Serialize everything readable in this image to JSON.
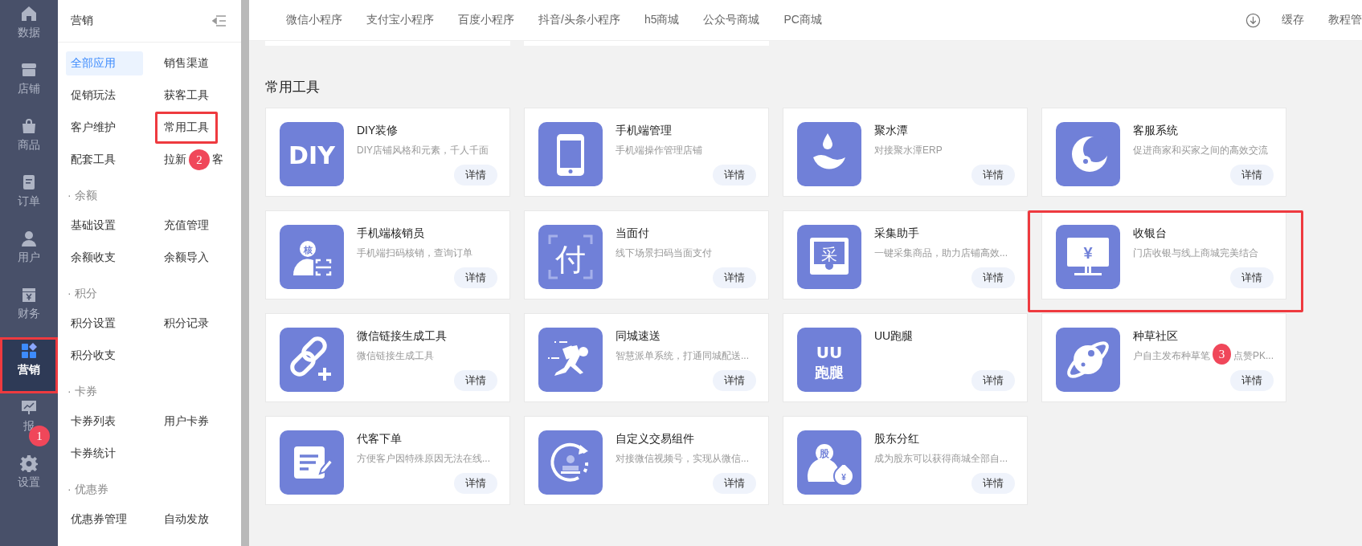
{
  "nav": [
    {
      "label": "数据",
      "selected": false,
      "highlighted": false
    },
    {
      "label": "店铺",
      "selected": false,
      "highlighted": false
    },
    {
      "label": "商品",
      "selected": false,
      "highlighted": false
    },
    {
      "label": "订单",
      "selected": false,
      "highlighted": false
    },
    {
      "label": "用户",
      "selected": false,
      "highlighted": false
    },
    {
      "label": "财务",
      "selected": false,
      "highlighted": false
    },
    {
      "label": "营销",
      "selected": true,
      "highlighted": true
    },
    {
      "label": "报",
      "selected": false,
      "highlighted": false,
      "badge": "1"
    },
    {
      "label": "设置",
      "selected": false,
      "highlighted": false
    }
  ],
  "sidebar": {
    "title": "营销",
    "sections": [
      {
        "items": [
          {
            "label": "全部应用",
            "selected": true,
            "highlighted": false
          },
          {
            "label": "销售渠道",
            "selected": false,
            "highlighted": false
          },
          {
            "label": "促销玩法",
            "selected": false,
            "highlighted": false
          },
          {
            "label": "获客工具",
            "selected": false,
            "highlighted": false
          },
          {
            "label": "客户维护",
            "selected": false,
            "highlighted": false
          },
          {
            "label": "常用工具",
            "selected": false,
            "highlighted": true
          },
          {
            "label": "配套工具",
            "selected": false,
            "highlighted": false
          },
          {
            "label": "拉新",
            "label_after": "客",
            "badge": "2",
            "selected": false,
            "highlighted": false
          }
        ]
      },
      {
        "title": "· 余额",
        "items": [
          {
            "label": "基础设置",
            "selected": false,
            "highlighted": false
          },
          {
            "label": "充值管理",
            "selected": false,
            "highlighted": false
          },
          {
            "label": "余额收支",
            "selected": false,
            "highlighted": false
          },
          {
            "label": "余额导入",
            "selected": false,
            "highlighted": false
          }
        ]
      },
      {
        "title": "· 积分",
        "items": [
          {
            "label": "积分设置",
            "selected": false,
            "highlighted": false
          },
          {
            "label": "积分记录",
            "selected": false,
            "highlighted": false
          },
          {
            "label": "积分收支",
            "selected": false,
            "highlighted": false
          }
        ]
      },
      {
        "title": "· 卡券",
        "items": [
          {
            "label": "卡券列表",
            "selected": false,
            "highlighted": false
          },
          {
            "label": "用户卡券",
            "selected": false,
            "highlighted": false
          },
          {
            "label": "卡券统计",
            "selected": false,
            "highlighted": false
          }
        ]
      },
      {
        "title": "· 优惠券",
        "items": [
          {
            "label": "优惠券管理",
            "selected": false,
            "highlighted": false
          },
          {
            "label": "自动发放",
            "selected": false,
            "highlighted": false
          }
        ]
      }
    ]
  },
  "tabs": [
    "微信小程序",
    "支付宝小程序",
    "百度小程序",
    "抖音/头条小程序",
    "h5商城",
    "公众号商城",
    "PC商城"
  ],
  "top_actions": [
    "缓存",
    "教程管"
  ],
  "section_title": "常用工具",
  "cards": [
    {
      "title": "DIY装修",
      "desc": "DIY店铺风格和元素，千人千面",
      "button": "详情",
      "highlighted": false,
      "icon_text": [
        "DIY"
      ]
    },
    {
      "title": "手机端管理",
      "desc": "手机端操作管理店铺",
      "button": "详情",
      "highlighted": false
    },
    {
      "title": "聚水潭",
      "desc": "对接聚水潭ERP",
      "button": "详情",
      "highlighted": false
    },
    {
      "title": "客服系统",
      "desc": "促进商家和买家之间的高效交流",
      "button": "详情",
      "highlighted": false
    },
    {
      "title": "手机端核销员",
      "desc": "手机端扫码核销，查询订单",
      "button": "详情",
      "highlighted": false,
      "icon_text": [
        "核"
      ]
    },
    {
      "title": "当面付",
      "desc": "线下场景扫码当面支付",
      "button": "详情",
      "highlighted": false,
      "icon_text": [
        "付"
      ]
    },
    {
      "title": "采集助手",
      "desc": "一键采集商品，助力店铺高效...",
      "button": "详情",
      "highlighted": false,
      "icon_text": [
        "采"
      ]
    },
    {
      "title": "收银台",
      "desc": "门店收银与线上商城完美结合",
      "button": "详情",
      "highlighted": true,
      "icon_text": [
        "¥"
      ]
    },
    {
      "title": "微信链接生成工具",
      "desc": "微信链接生成工具",
      "button": "详情",
      "highlighted": false
    },
    {
      "title": "同城速送",
      "desc": "智慧派单系统，打通同城配送...",
      "button": "详情",
      "highlighted": false
    },
    {
      "title": "UU跑腿",
      "button": "详情",
      "highlighted": false,
      "icon_text": [
        "UU",
        "跑腿"
      ]
    },
    {
      "title": "种草社区",
      "desc": "户自主发布种草笔",
      "desc_after": "点赞PK...",
      "badge": "3",
      "button": "详情",
      "highlighted": false
    },
    {
      "title": "代客下单",
      "desc": "方便客户因特殊原因无法在线...",
      "button": "详情",
      "highlighted": false
    },
    {
      "title": "自定义交易组件",
      "desc": "对接微信视频号，实现从微信...",
      "button": "详情",
      "highlighted": false
    },
    {
      "title": "股东分红",
      "desc": "成为股东可以获得商城全部自...",
      "button": "详情",
      "highlighted": false,
      "icon_text": [
        "股",
        "¥"
      ]
    }
  ]
}
